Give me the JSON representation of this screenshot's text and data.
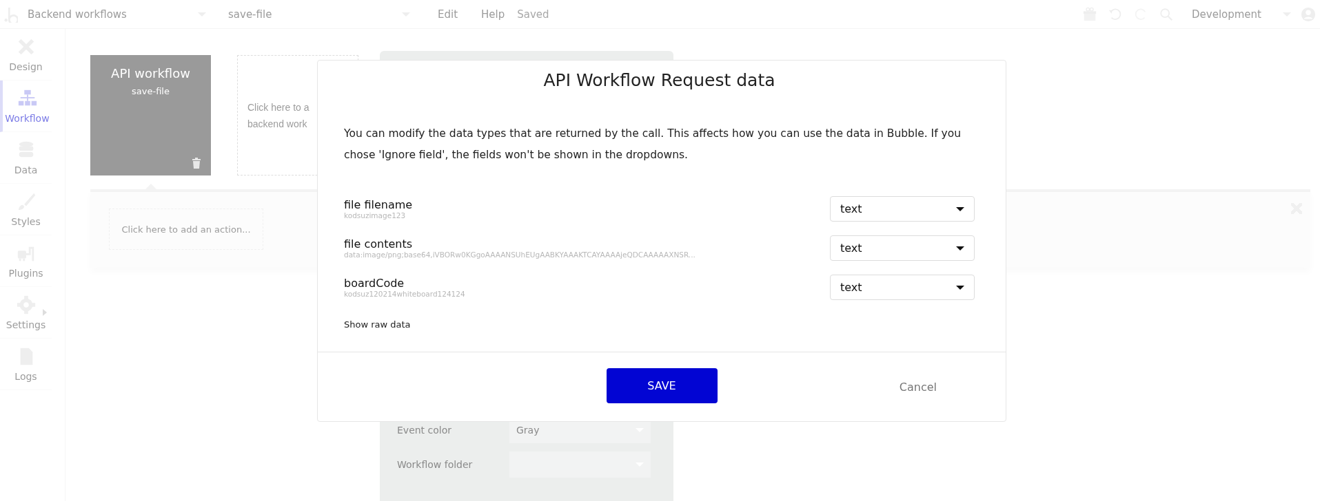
{
  "topbar": {
    "page": "Backend workflows",
    "workflow": "save-file",
    "menu": [
      "Edit",
      "Help"
    ],
    "status": "Saved",
    "environment": "Development"
  },
  "sidebar": {
    "items": [
      {
        "kind": "design",
        "label": "Design",
        "selected": false
      },
      {
        "kind": "workflow",
        "label": "Workflow",
        "selected": true
      },
      {
        "kind": "data",
        "label": "Data",
        "selected": false
      },
      {
        "kind": "styles",
        "label": "Styles",
        "selected": false
      },
      {
        "kind": "plugins",
        "label": "Plugins",
        "selected": false
      },
      {
        "kind": "settings",
        "label": "Settings",
        "selected": false
      },
      {
        "kind": "logs",
        "label": "Logs",
        "selected": false
      }
    ]
  },
  "canvas": {
    "event_card": {
      "title": "API workflow",
      "subtitle": "save-file"
    },
    "add_card": {
      "lines": [
        "Click here to a",
        "backend work"
      ]
    },
    "action_placeholder": "Click here to add an action..."
  },
  "property_panel": {
    "rows": [
      {
        "label": "Event color",
        "value": "Gray"
      },
      {
        "label": "Workflow folder"
      }
    ]
  },
  "modal": {
    "title": "API Workflow Request data",
    "description": "You can modify the data types that are returned by the call. This affects how you can use the data in Bubble. If you chose 'Ignore field', the fields won't be shown in the dropdowns.",
    "fields": [
      {
        "name": "file filename",
        "sample": "kodsuzimage123",
        "type": "text"
      },
      {
        "name": "file contents",
        "sample": "data:image/png;base64,iVBORw0KGgoAAAANSUhEUgAABKYAAAKTCAYAAAAjeQDCAAAAAXNSR...",
        "type": "text"
      },
      {
        "name": "boardCode",
        "sample": "kodsuz120214whiteboard124124",
        "type": "text"
      }
    ],
    "raw_link": "Show raw data",
    "save": "SAVE",
    "cancel": "Cancel"
  }
}
